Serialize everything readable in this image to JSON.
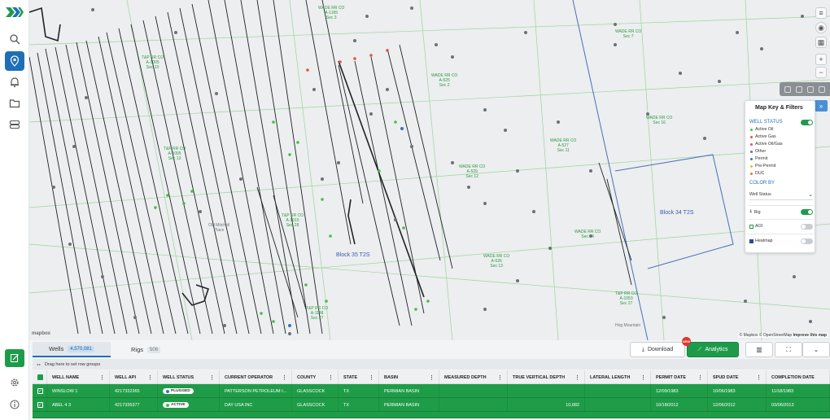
{
  "sidebar": {
    "items": [
      {
        "name": "search-icon"
      },
      {
        "name": "map-pin-icon",
        "active": true
      },
      {
        "name": "bell-icon"
      },
      {
        "name": "folder-icon"
      },
      {
        "name": "database-icon"
      }
    ],
    "bottom_items": [
      {
        "name": "edit-note-icon"
      },
      {
        "name": "gear-icon"
      },
      {
        "name": "info-icon"
      }
    ]
  },
  "map": {
    "labels": [
      {
        "text": "WADE RR CO\nA-1165\nSec 3"
      },
      {
        "text": "T&P RR CO\nA-1005\nSec 10"
      },
      {
        "text": "WADE RR CO\nA-525\nSec 2"
      },
      {
        "text": "WADE RR CO\nA-527\nSec 11"
      },
      {
        "text": "WADE RR CO\nA-529\nSec 12"
      },
      {
        "text": "T&P RR CO\nA-1005\nSec 13"
      },
      {
        "text": "WADE RR CO\nA-526\nSec 13"
      },
      {
        "text": "T&P RR CO\nA-1015\nSec 28"
      },
      {
        "text": "T&P RR CO\nA-1148\nSec 27"
      },
      {
        "text": "WADE RR CO\nSec 7"
      },
      {
        "text": "WADE RR CO\nSec 14"
      },
      {
        "text": "WADE RR CO\nSec 16"
      },
      {
        "text": "T&P RR CO\nA-1053\nSec 27"
      }
    ],
    "blocks": [
      {
        "text": "Block 35 T2S"
      },
      {
        "text": "Block 34 T2S"
      }
    ],
    "places": [
      {
        "text": "Old Mitchell\nPlace"
      },
      {
        "text": "Hog Mountain"
      }
    ],
    "attribution": {
      "mapbox": "© Mapbox",
      "osm": "© OpenStreetMap",
      "improve": "Improve this map",
      "logo": "mapbox"
    }
  },
  "map_key": {
    "title": "Map Key & Filters",
    "well_status_label": "WELL STATUS",
    "statuses": [
      {
        "label": "Active Oil",
        "color": "#4cbb4a"
      },
      {
        "label": "Active Gas",
        "color": "#e0544a"
      },
      {
        "label": "Active Oil/Gas",
        "color": "#d94f8a"
      },
      {
        "label": "Other",
        "color": "#6b7178"
      },
      {
        "label": "Permit",
        "color": "#3f6fbf"
      },
      {
        "label": "Pre-Permit",
        "color": "#c8c93a"
      },
      {
        "label": "DUC",
        "color": "#e07b2b"
      }
    ],
    "color_by_label": "COLOR BY",
    "color_by_value": "Well Status",
    "rig_label": "Rig",
    "aoi_label": "AOI",
    "heatmap_label": "Heatmap"
  },
  "bottom": {
    "tabs": [
      {
        "label": "Wells",
        "count": "4,570,081"
      },
      {
        "label": "Rigs",
        "count": "506"
      }
    ],
    "download_label": "Download",
    "analytics_label": "Analytics",
    "new_badge": "NEW",
    "group_hint": "Drag here to set row groups"
  },
  "table": {
    "columns": [
      "WELL NAME",
      "WELL API",
      "WELL STATUS",
      "CURRENT OPERATOR",
      "COUNTY",
      "STATE",
      "BASIN",
      "MEASURED DEPTH",
      "TRUE VERTICAL DEPTH",
      "LATERAL LENGTH",
      "PERMIT DATE",
      "SPUD DATE",
      "COMPLETION DATE"
    ],
    "rows": [
      {
        "name": "WINSLOW 1",
        "api": "4217332365",
        "status": "PLUGGED",
        "status_color": "#3f6fbf",
        "operator": "PATTERSON PETROLEUM I...",
        "county": "GLASSCOCK",
        "state": "TX",
        "basin": "PERMIAN BASIN",
        "md": "",
        "tvd": "",
        "lateral": "",
        "permit": "12/09/1983",
        "spud": "10/06/1983",
        "completion": "11/18/1983"
      },
      {
        "name": "ABEL 4 3",
        "api": "4217335377",
        "status": "ACTIVE",
        "status_color": "#4cbb4a",
        "operator": "DAY USA INC",
        "county": "GLASSCOCK",
        "state": "TX",
        "basin": "PERMIAN BASIN",
        "md": "",
        "tvd": "10,682",
        "lateral": "",
        "permit": "10/18/2012",
        "spud": "12/06/2012",
        "completion": "03/06/2013"
      }
    ]
  }
}
